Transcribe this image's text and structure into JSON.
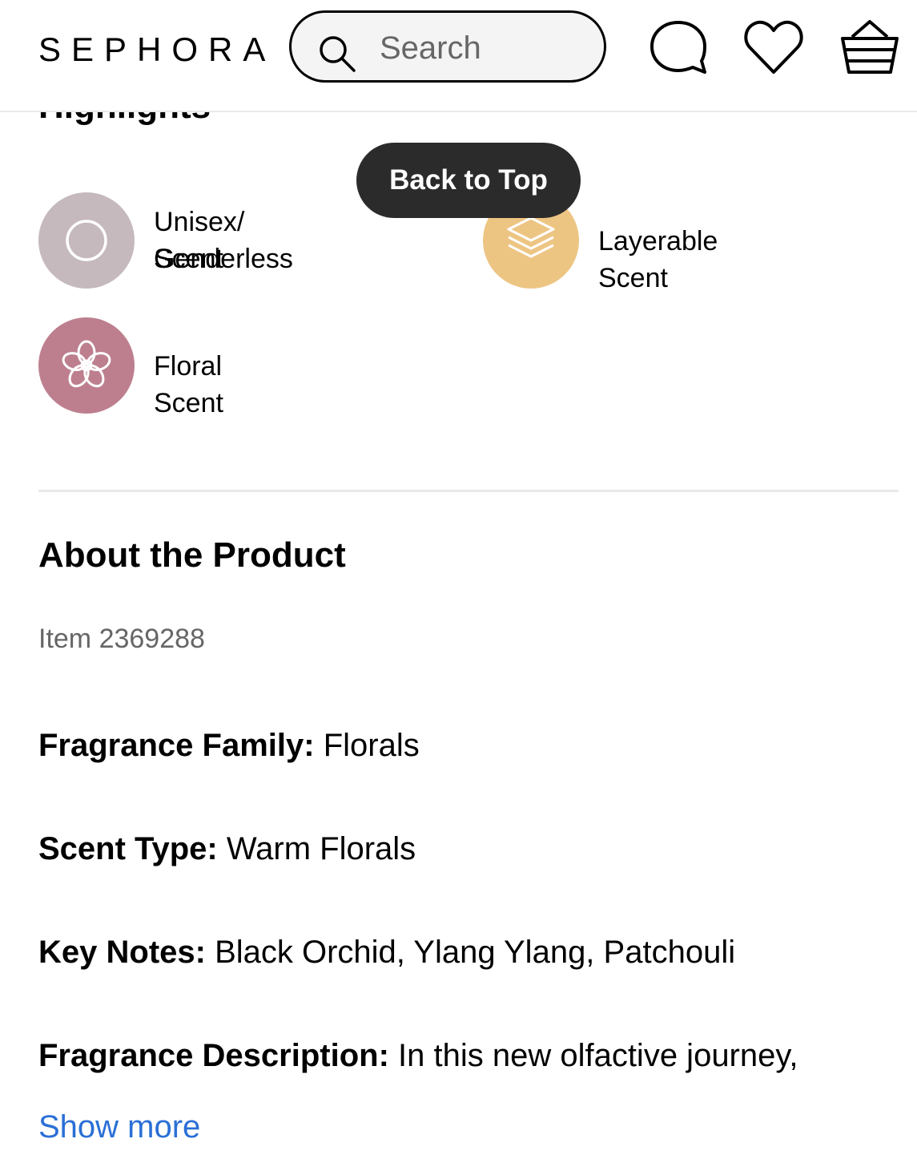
{
  "header": {
    "logo": "SEPHORA",
    "search_placeholder": "Search",
    "icons": [
      "search-icon",
      "chat-icon",
      "heart-icon",
      "basket-icon"
    ]
  },
  "highlights": {
    "title": "Highlights",
    "back_to_top": "Back to Top",
    "items": [
      {
        "label_line1": "Unisex/ Genderless",
        "label_line2": "Scent",
        "icon": "circle-icon",
        "color": "#c5b9bd"
      },
      {
        "label": "Layerable Scent",
        "icon": "layers-icon",
        "color": "#edc583"
      },
      {
        "label": "Floral Scent",
        "icon": "flower-icon",
        "color": "#bd7f8e"
      }
    ]
  },
  "about": {
    "title": "About the Product",
    "item_number": "Item 2369288",
    "attributes": [
      {
        "key": "Fragrance Family:",
        "value": " Florals"
      },
      {
        "key": "Scent Type:",
        "value": " Warm Florals"
      },
      {
        "key": "Key Notes:",
        "value": " Black Orchid, Ylang Ylang, Patchouli"
      },
      {
        "key": "Fragrance Description:",
        "value": " In this new olfactive journey,"
      }
    ],
    "show_more": "Show more"
  },
  "colors": {
    "link": "#2a6fd6",
    "pill": "#2b2b2b",
    "divider": "#e9e9e9"
  }
}
